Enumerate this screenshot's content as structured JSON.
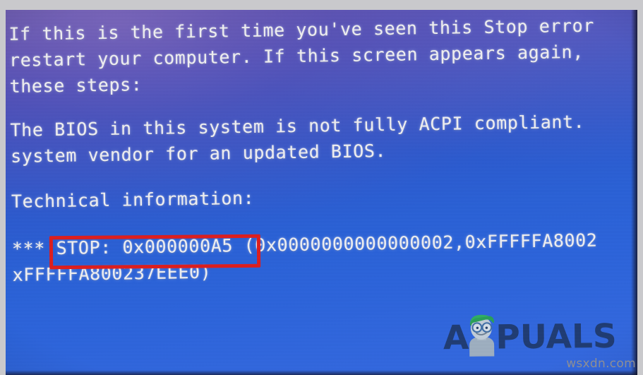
{
  "screen": {
    "type": "windows-blue-screen-of-death",
    "background_top_color": "#5a4fa8",
    "background_bottom_color": "#3368e2",
    "text_color": "#f2f2f4"
  },
  "message": {
    "paragraph_1": [
      "If this is the first time you've seen this Stop error",
      "restart your computer. If this screen appears again,",
      "these steps:"
    ],
    "paragraph_2": [
      "The BIOS in this system is not fully ACPI compliant.",
      "system vendor for an updated BIOS."
    ],
    "paragraph_3": [
      "Technical information:"
    ],
    "paragraph_4": [
      "*** STOP: 0x000000A5 (0x0000000000000002,0xFFFFFA8002",
      "xFFFFFA800237EEE0)"
    ]
  },
  "stop_code": {
    "prefix": "*** STOP:",
    "code": "0x000000A5",
    "parameter_1": "0x0000000000000002",
    "parameter_2": "0xFFFFFA8002",
    "parameter_2_wrapped": "xFFFFFA800237EEE0)",
    "highlight_color": "#e01b1b",
    "highlight_label": "stop-code-highlight"
  },
  "logo": {
    "letter_a": "A",
    "rest": "PUALS",
    "full_name": "APPUALS",
    "text_color": "#1d3a73",
    "mascot_hair_color": "#2eaf62",
    "mascot_skin_color": "#b9c6d4"
  },
  "watermark": {
    "text": "wsxdn.com",
    "color": "#8e8e93"
  }
}
